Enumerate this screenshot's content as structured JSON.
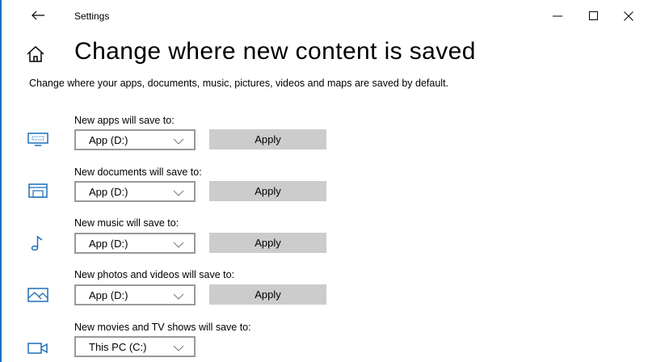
{
  "window": {
    "title": "Settings"
  },
  "page": {
    "title": "Change where new content is saved",
    "description": "Change where your apps, documents, music, pictures, videos and maps are saved by default."
  },
  "rows": [
    {
      "label": "New apps will save to:",
      "icon": "monitor-icon",
      "value": "App (D:)",
      "apply": "Apply"
    },
    {
      "label": "New documents will save to:",
      "icon": "documents-drive-icon",
      "value": "App (D:)",
      "apply": "Apply"
    },
    {
      "label": "New music will save to:",
      "icon": "music-note-icon",
      "value": "App (D:)",
      "apply": "Apply"
    },
    {
      "label": "New photos and videos will save to:",
      "icon": "photo-icon",
      "value": "App (D:)",
      "apply": "Apply"
    },
    {
      "label": "New movies and TV shows will save to:",
      "icon": "video-camera-icon",
      "value": "This PC (C:)"
    }
  ],
  "colors": {
    "accent": "#1f6fb8",
    "apply_bg": "#cccccc",
    "dropdown_border": "#999999"
  }
}
